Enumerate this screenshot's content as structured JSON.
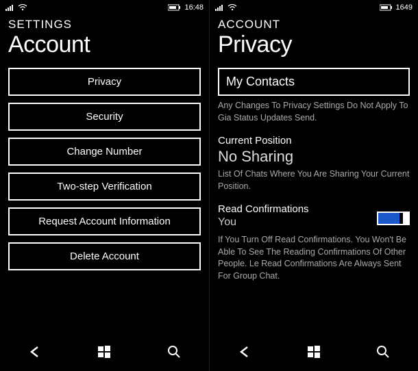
{
  "left": {
    "status": {
      "time": "16:48"
    },
    "breadcrumb": "SETTINGS",
    "title": "Account",
    "items": [
      {
        "label": "Privacy"
      },
      {
        "label": "Security"
      },
      {
        "label": "Change Number"
      },
      {
        "label": "Two-step Verification"
      },
      {
        "label": "Request Account Information"
      },
      {
        "label": "Delete Account"
      }
    ]
  },
  "right": {
    "status": {
      "time": "1649"
    },
    "breadcrumb": "ACCOUNT",
    "title": "Privacy",
    "contacts_value": "My Contacts",
    "contacts_hint": "Any Changes To Privacy Settings Do Not Apply To Gia Status Updates Send.",
    "position_label": "Current Position",
    "position_value": "No Sharing",
    "position_hint": "List Of Chats Where You Are Sharing Your Current Position.",
    "read_label": "Read Confirmations",
    "read_value": "You",
    "read_hint": "If You Turn Off Read Confirmations. You Won't Be Able To See The Reading Confirmations Of Other People. Le Read Confirmations Are Always Sent For Group Chat."
  }
}
